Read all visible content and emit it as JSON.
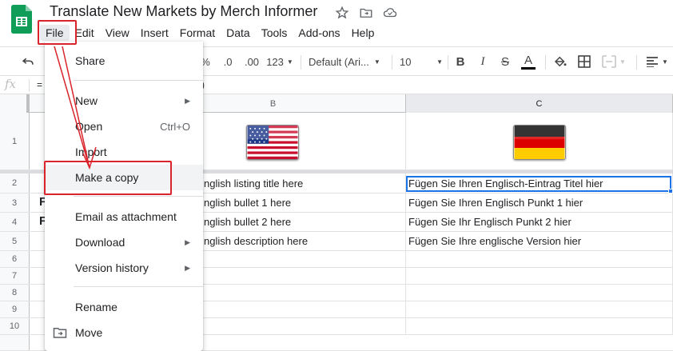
{
  "document": {
    "title": "Translate New Markets by Merch Informer"
  },
  "menubar": {
    "items": [
      "File",
      "Edit",
      "View",
      "Insert",
      "Format",
      "Data",
      "Tools",
      "Add-ons",
      "Help"
    ]
  },
  "toolbar": {
    "percent": "%",
    "decimal_decrease": ".0",
    "decimal_increase": ".00",
    "number_format": "123",
    "font_family": "Default (Ari...",
    "font_size": "10",
    "bold": "B",
    "italic": "I",
    "strikethrough": "S",
    "text_color": "A"
  },
  "formula_bar": {
    "fx": "fx",
    "content_start": "=",
    "content_end": ")"
  },
  "grid": {
    "columns": [
      "B",
      "C"
    ],
    "row_numbers": [
      "1",
      "2",
      "3",
      "4",
      "5",
      "6",
      "7",
      "8",
      "9",
      "10"
    ],
    "column_b": [
      "nglish listing title here",
      "nglish bullet 1 here",
      "nglish bullet 2 here",
      "nglish description here"
    ],
    "column_c": [
      "Fügen Sie Ihren Englisch-Eintrag Titel hier",
      "Fügen Sie Ihren Englisch Punkt 1 hier",
      "Fügen Sie Ihr Englisch Punkt 2 hier",
      "Fügen Sie Ihre englische Version hier"
    ],
    "partial_a_letters": [
      "F",
      "F"
    ]
  },
  "file_menu": {
    "share": "Share",
    "new": "New",
    "open": "Open",
    "open_shortcut": "Ctrl+O",
    "import": "Import",
    "make_copy": "Make a copy",
    "email": "Email as attachment",
    "download": "Download",
    "version_history": "Version history",
    "rename": "Rename",
    "move": "Move"
  },
  "colors": {
    "sheets_green": "#0f9d58",
    "annotation_red": "#d9242b",
    "selection_blue": "#1a73e8"
  }
}
